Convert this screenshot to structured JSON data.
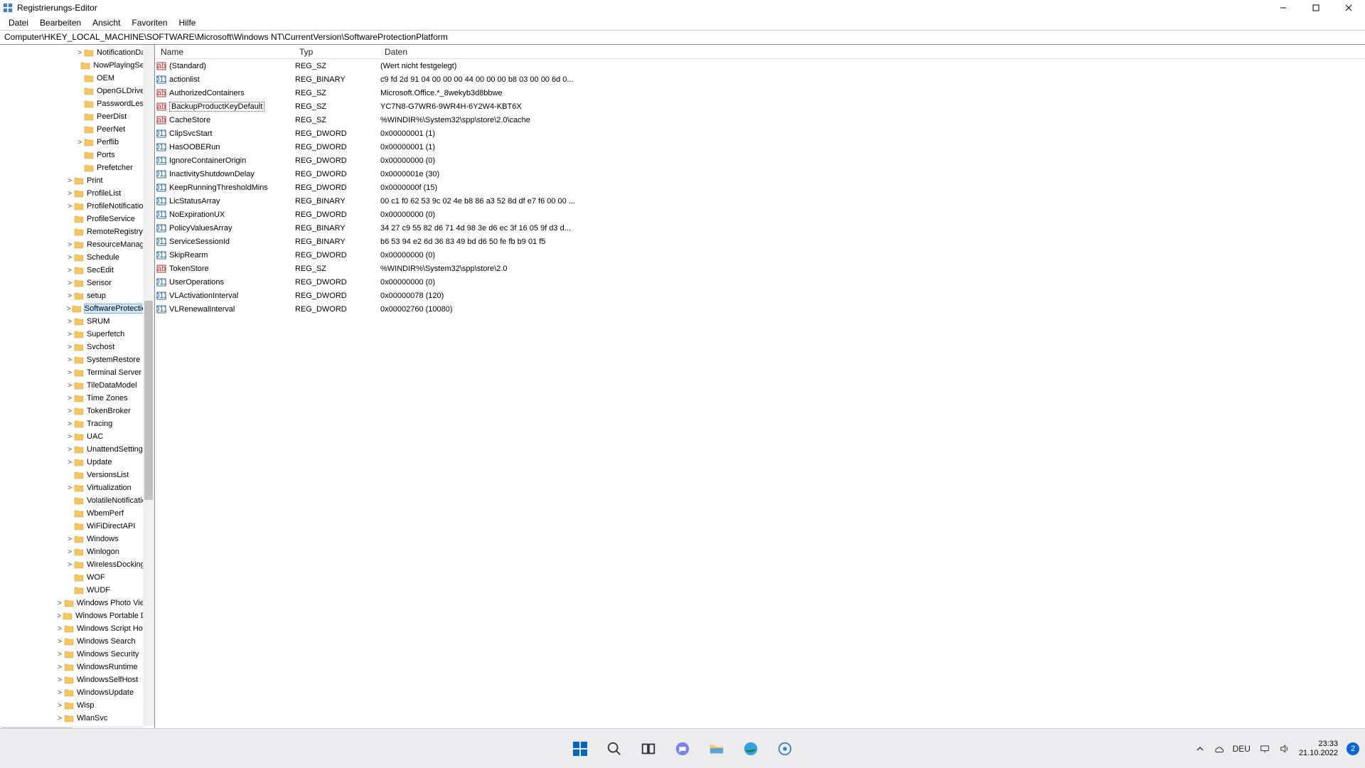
{
  "window": {
    "title": "Registrierungs-Editor"
  },
  "menu": [
    "Datei",
    "Bearbeiten",
    "Ansicht",
    "Favoriten",
    "Hilfe"
  ],
  "address": "Computer\\HKEY_LOCAL_MACHINE\\SOFTWARE\\Microsoft\\Windows NT\\CurrentVersion\\SoftwareProtectionPlatform",
  "columns": {
    "name": "Name",
    "type": "Typ",
    "data": "Daten"
  },
  "tree": [
    {
      "indent": 106,
      "exp": ">",
      "label": "NotificationData"
    },
    {
      "indent": 106,
      "exp": "",
      "label": "NowPlayingSessionManager"
    },
    {
      "indent": 106,
      "exp": "",
      "label": "OEM"
    },
    {
      "indent": 106,
      "exp": "",
      "label": "OpenGLDrivers"
    },
    {
      "indent": 106,
      "exp": "",
      "label": "PasswordLess"
    },
    {
      "indent": 106,
      "exp": "",
      "label": "PeerDist"
    },
    {
      "indent": 106,
      "exp": "",
      "label": "PeerNet"
    },
    {
      "indent": 106,
      "exp": ">",
      "label": "Perflib"
    },
    {
      "indent": 106,
      "exp": "",
      "label": "Ports"
    },
    {
      "indent": 106,
      "exp": "",
      "label": "Prefetcher"
    },
    {
      "indent": 92,
      "exp": ">",
      "label": "Print"
    },
    {
      "indent": 92,
      "exp": ">",
      "label": "ProfileList"
    },
    {
      "indent": 92,
      "exp": ">",
      "label": "ProfileNotification"
    },
    {
      "indent": 92,
      "exp": "",
      "label": "ProfileService"
    },
    {
      "indent": 92,
      "exp": "",
      "label": "RemoteRegistry"
    },
    {
      "indent": 92,
      "exp": ">",
      "label": "ResourceManager"
    },
    {
      "indent": 92,
      "exp": ">",
      "label": "Schedule"
    },
    {
      "indent": 92,
      "exp": ">",
      "label": "SecEdit"
    },
    {
      "indent": 92,
      "exp": ">",
      "label": "Sensor"
    },
    {
      "indent": 92,
      "exp": ">",
      "label": "setup"
    },
    {
      "indent": 92,
      "exp": ">",
      "label": "SoftwareProtectionPlatform",
      "selected": true
    },
    {
      "indent": 92,
      "exp": ">",
      "label": "SRUM"
    },
    {
      "indent": 92,
      "exp": ">",
      "label": "Superfetch"
    },
    {
      "indent": 92,
      "exp": ">",
      "label": "Svchost"
    },
    {
      "indent": 92,
      "exp": ">",
      "label": "SystemRestore"
    },
    {
      "indent": 92,
      "exp": ">",
      "label": "Terminal Server"
    },
    {
      "indent": 92,
      "exp": ">",
      "label": "TileDataModel"
    },
    {
      "indent": 92,
      "exp": ">",
      "label": "Time Zones"
    },
    {
      "indent": 92,
      "exp": ">",
      "label": "TokenBroker"
    },
    {
      "indent": 92,
      "exp": ">",
      "label": "Tracing"
    },
    {
      "indent": 92,
      "exp": ">",
      "label": "UAC"
    },
    {
      "indent": 92,
      "exp": ">",
      "label": "UnattendSettings"
    },
    {
      "indent": 92,
      "exp": ">",
      "label": "Update"
    },
    {
      "indent": 92,
      "exp": "",
      "label": "VersionsList"
    },
    {
      "indent": 92,
      "exp": ">",
      "label": "Virtualization"
    },
    {
      "indent": 92,
      "exp": "",
      "label": "VolatileNotifications"
    },
    {
      "indent": 92,
      "exp": "",
      "label": "WbemPerf"
    },
    {
      "indent": 92,
      "exp": "",
      "label": "WiFiDirectAPI"
    },
    {
      "indent": 92,
      "exp": ">",
      "label": "Windows"
    },
    {
      "indent": 92,
      "exp": ">",
      "label": "Winlogon"
    },
    {
      "indent": 92,
      "exp": ">",
      "label": "WirelessDocking"
    },
    {
      "indent": 92,
      "exp": "",
      "label": "WOF"
    },
    {
      "indent": 92,
      "exp": "",
      "label": "WUDF"
    },
    {
      "indent": 78,
      "exp": ">",
      "label": "Windows Photo Viewer"
    },
    {
      "indent": 78,
      "exp": ">",
      "label": "Windows Portable Devices"
    },
    {
      "indent": 78,
      "exp": ">",
      "label": "Windows Script Host"
    },
    {
      "indent": 78,
      "exp": ">",
      "label": "Windows Search"
    },
    {
      "indent": 78,
      "exp": ">",
      "label": "Windows Security"
    },
    {
      "indent": 78,
      "exp": ">",
      "label": "WindowsRuntime"
    },
    {
      "indent": 78,
      "exp": ">",
      "label": "WindowsSelfHost"
    },
    {
      "indent": 78,
      "exp": ">",
      "label": "WindowsUpdate"
    },
    {
      "indent": 78,
      "exp": ">",
      "label": "Wisp"
    },
    {
      "indent": 78,
      "exp": ">",
      "label": "WlanSvc"
    }
  ],
  "values": [
    {
      "icon": "sz",
      "name": "(Standard)",
      "type": "REG_SZ",
      "data": "(Wert nicht festgelegt)"
    },
    {
      "icon": "bin",
      "name": "actionlist",
      "type": "REG_BINARY",
      "data": "c9 fd 2d 91 04 00 00 00 44 00 00 00 b8 03 00 00 6d 0..."
    },
    {
      "icon": "sz",
      "name": "AuthorizedContainers",
      "type": "REG_SZ",
      "data": "Microsoft.Office.*_8wekyb3d8bbwe"
    },
    {
      "icon": "sz",
      "name": "BackupProductKeyDefault",
      "type": "REG_SZ",
      "data": "YC7N8-G7WR6-9WR4H-6Y2W4-KBT6X",
      "highlight": true
    },
    {
      "icon": "sz",
      "name": "CacheStore",
      "type": "REG_SZ",
      "data": "%WINDIR%\\System32\\spp\\store\\2.0\\cache"
    },
    {
      "icon": "bin",
      "name": "ClipSvcStart",
      "type": "REG_DWORD",
      "data": "0x00000001 (1)"
    },
    {
      "icon": "bin",
      "name": "HasOOBERun",
      "type": "REG_DWORD",
      "data": "0x00000001 (1)"
    },
    {
      "icon": "bin",
      "name": "IgnoreContainerOrigin",
      "type": "REG_DWORD",
      "data": "0x00000000 (0)"
    },
    {
      "icon": "bin",
      "name": "InactivityShutdownDelay",
      "type": "REG_DWORD",
      "data": "0x0000001e (30)"
    },
    {
      "icon": "bin",
      "name": "KeepRunningThresholdMins",
      "type": "REG_DWORD",
      "data": "0x0000000f (15)"
    },
    {
      "icon": "bin",
      "name": "LicStatusArray",
      "type": "REG_BINARY",
      "data": "00 c1 f0 62 53 9c 02 4e b8 86 a3 52 8d df e7 f6 00 00 ..."
    },
    {
      "icon": "bin",
      "name": "NoExpirationUX",
      "type": "REG_DWORD",
      "data": "0x00000000 (0)"
    },
    {
      "icon": "bin",
      "name": "PolicyValuesArray",
      "type": "REG_BINARY",
      "data": "34 27 c9 55 82 d6 71 4d 98 3e d6 ec 3f 16 05 9f d3 d..."
    },
    {
      "icon": "bin",
      "name": "ServiceSessionId",
      "type": "REG_BINARY",
      "data": "b6 53 94 e2 6d 36 83 49 bd d6 50 fe fb b9 01 f5"
    },
    {
      "icon": "bin",
      "name": "SkipRearm",
      "type": "REG_DWORD",
      "data": "0x00000000 (0)"
    },
    {
      "icon": "sz",
      "name": "TokenStore",
      "type": "REG_SZ",
      "data": "%WINDIR%\\System32\\spp\\store\\2.0"
    },
    {
      "icon": "bin",
      "name": "UserOperations",
      "type": "REG_DWORD",
      "data": "0x00000000 (0)"
    },
    {
      "icon": "bin",
      "name": "VLActivationInterval",
      "type": "REG_DWORD",
      "data": "0x00000078 (120)"
    },
    {
      "icon": "bin",
      "name": "VLRenewalInterval",
      "type": "REG_DWORD",
      "data": "0x00002760 (10080)"
    }
  ],
  "taskbar": {
    "lang": "DEU",
    "time": "23:33",
    "date": "21.10.2022",
    "notif_count": "2"
  }
}
